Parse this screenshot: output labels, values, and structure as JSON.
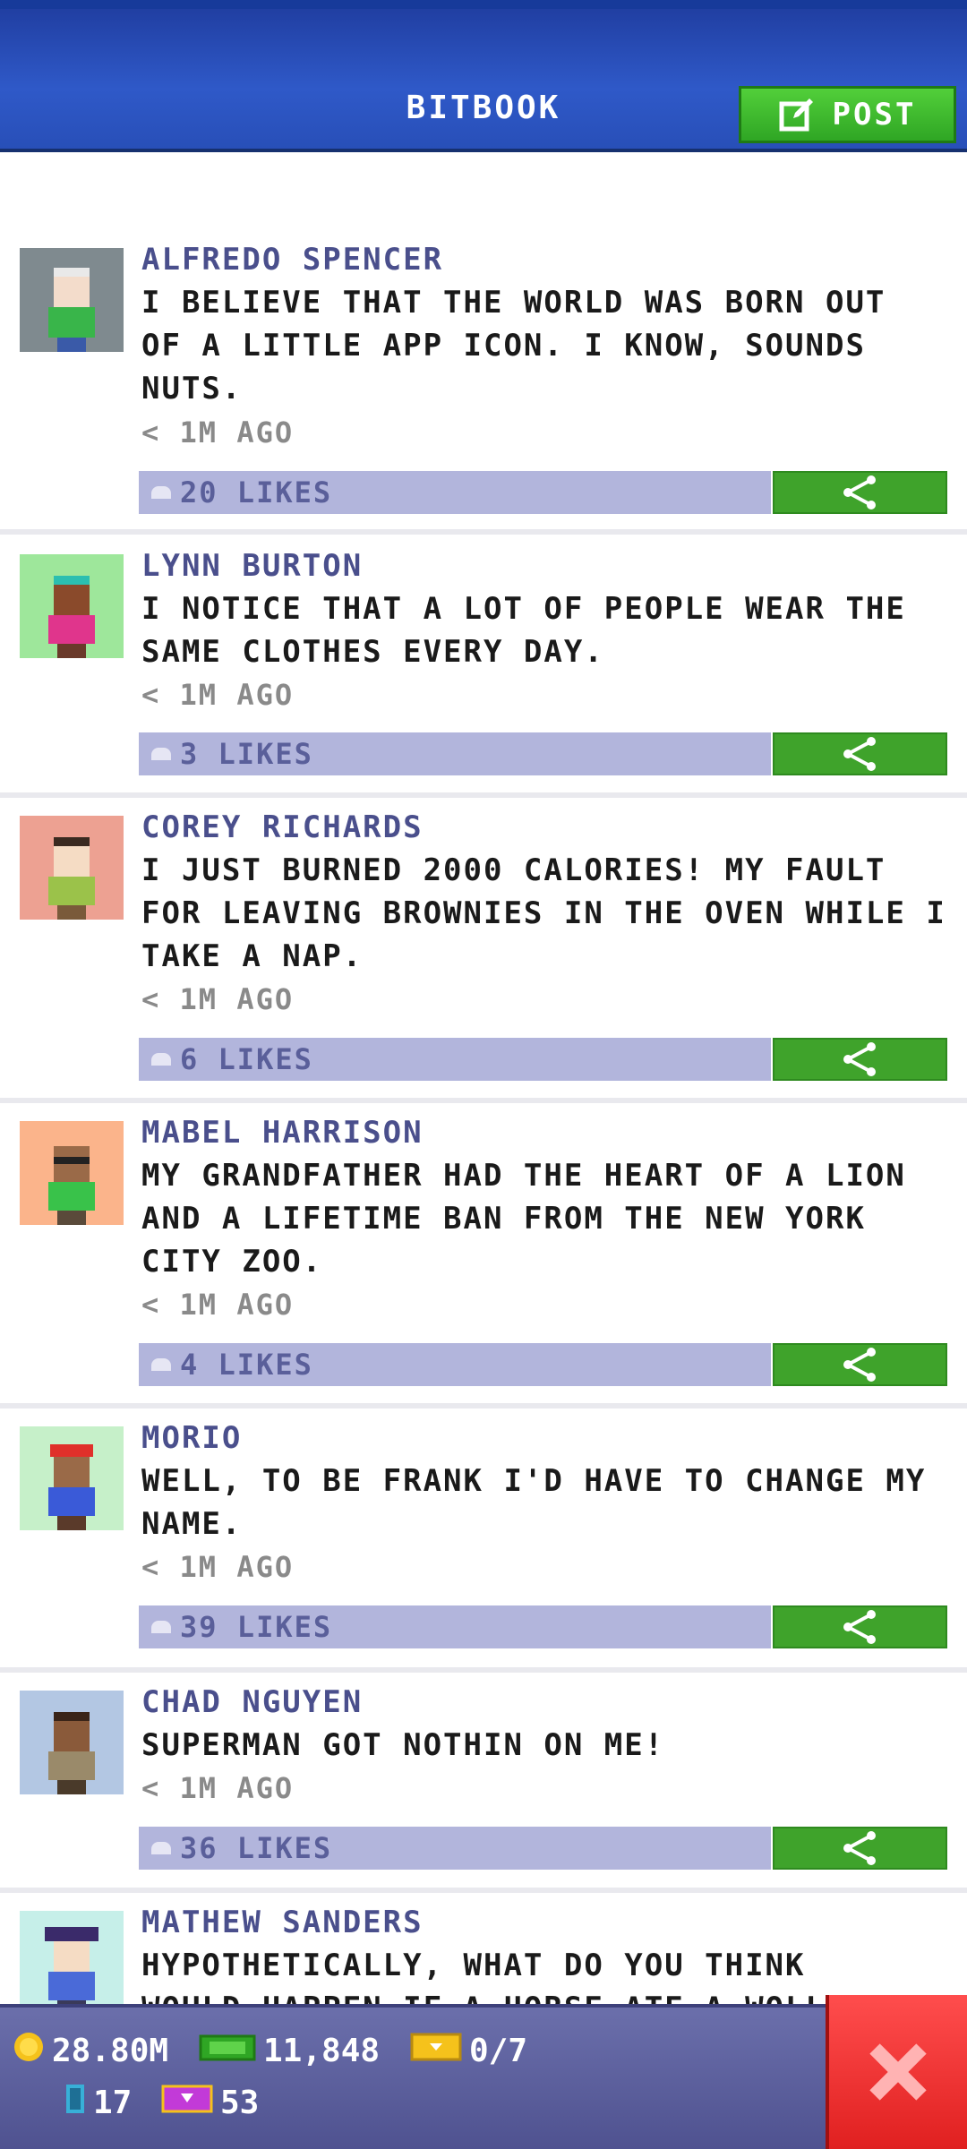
{
  "header": {
    "title": "BITBOOK",
    "post_label": "POST"
  },
  "posts": [
    {
      "author": "ALFREDO SPENCER",
      "text": "I BELIEVE THAT THE WORLD WAS BORN OUT\nOF A LITTLE APP ICON. I KNOW, SOUNDS\nNUTS.",
      "time": "< 1M AGO",
      "likes": "20 LIKES",
      "avatar_bg": "#7f8a8f"
    },
    {
      "author": "LYNN BURTON",
      "text": "I NOTICE THAT A LOT OF PEOPLE WEAR THE\nSAME CLOTHES EVERY DAY.",
      "time": "< 1M AGO",
      "likes": "3 LIKES",
      "avatar_bg": "#9ee79b"
    },
    {
      "author": "COREY RICHARDS",
      "text": "I JUST BURNED 2000 CALORIES! MY FAULT\nFOR LEAVING BROWNIES IN THE OVEN WHILE I\nTAKE A NAP.",
      "time": "< 1M AGO",
      "likes": "6 LIKES",
      "avatar_bg": "#eda192"
    },
    {
      "author": "MABEL HARRISON",
      "text": "MY GRANDFATHER HAD THE HEART OF A LION\nAND A LIFETIME BAN FROM THE NEW YORK\nCITY ZOO.",
      "time": "< 1M AGO",
      "likes": "4 LIKES",
      "avatar_bg": "#fbb48b"
    },
    {
      "author": "MORIO",
      "text": "WELL, TO BE FRANK I'D HAVE TO CHANGE MY\nNAME.",
      "time": "< 1M AGO",
      "likes": "39 LIKES",
      "avatar_bg": "#c6f0c9"
    },
    {
      "author": "CHAD NGUYEN",
      "text": "SUPERMAN GOT NOTHIN ON ME!",
      "time": "< 1M AGO",
      "likes": "36 LIKES",
      "avatar_bg": "#b3c7e3"
    },
    {
      "author": "MATHEW SANDERS",
      "text": "HYPOTHETICALLY, WHAT DO YOU THINK\nWOULD HAPPEN IF A HORSE ATE A WOLL",
      "time": "",
      "likes": "",
      "avatar_bg": "#c6efe9"
    }
  ],
  "footer": {
    "coins": "28.80M",
    "bux": "11,848",
    "tickets": "0/7",
    "elevator": "17",
    "vip": "53"
  },
  "colors": {
    "header": "#2f59c8",
    "post_button": "#3fa32b",
    "likes_bar": "#b2b5dc",
    "close": "#ff4d4d"
  }
}
